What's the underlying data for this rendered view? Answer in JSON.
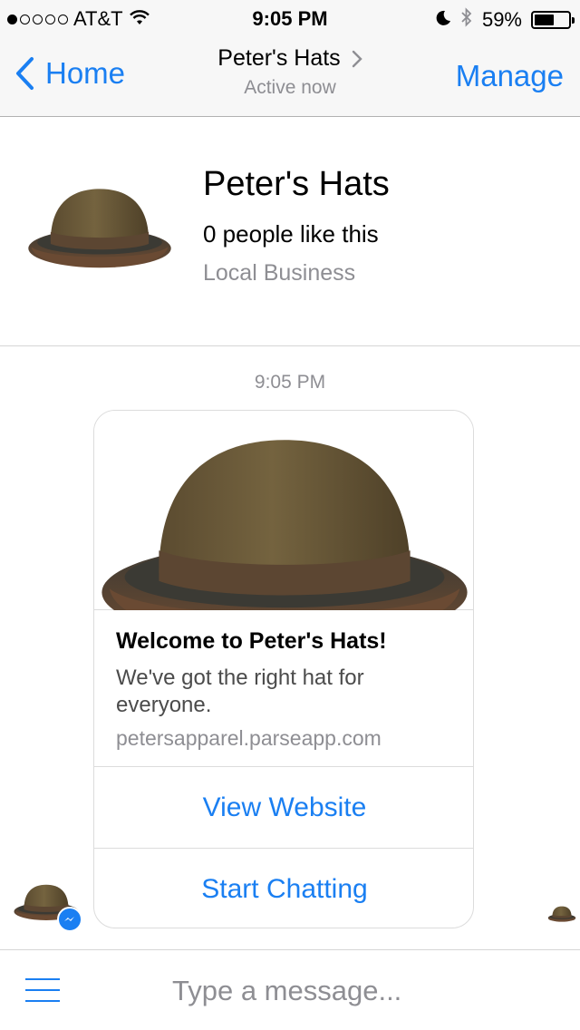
{
  "status_bar": {
    "carrier": "AT&T",
    "signal_bars_filled": 1,
    "signal_bars_total": 5,
    "time": "9:05 PM",
    "battery_percent": "59%",
    "battery_level": 0.59
  },
  "nav": {
    "back_label": "Home",
    "title": "Peter's Hats",
    "subtitle": "Active now",
    "manage_label": "Manage"
  },
  "page": {
    "name": "Peter's Hats",
    "likes": "0 people like this",
    "category": "Local Business"
  },
  "conversation": {
    "timestamp": "9:05 PM",
    "card": {
      "title": "Welcome to Peter's Hats!",
      "subtitle": "We've got the right hat for everyone.",
      "url": "petersapparel.parseapp.com",
      "buttons": [
        {
          "label": "View Website"
        },
        {
          "label": "Start Chatting"
        }
      ]
    }
  },
  "composer": {
    "placeholder": "Type a message..."
  },
  "colors": {
    "accent": "#1a7ff2",
    "hat_crown": "#6b5a3a",
    "hat_band": "#5a4632",
    "secondary_text": "#8e8e93"
  },
  "icons": {
    "back": "chevron-left-icon",
    "title_chevron": "chevron-right-icon",
    "wifi": "wifi-icon",
    "moon": "moon-icon",
    "bluetooth": "bluetooth-icon",
    "menu": "menu-icon",
    "messenger": "messenger-icon"
  }
}
